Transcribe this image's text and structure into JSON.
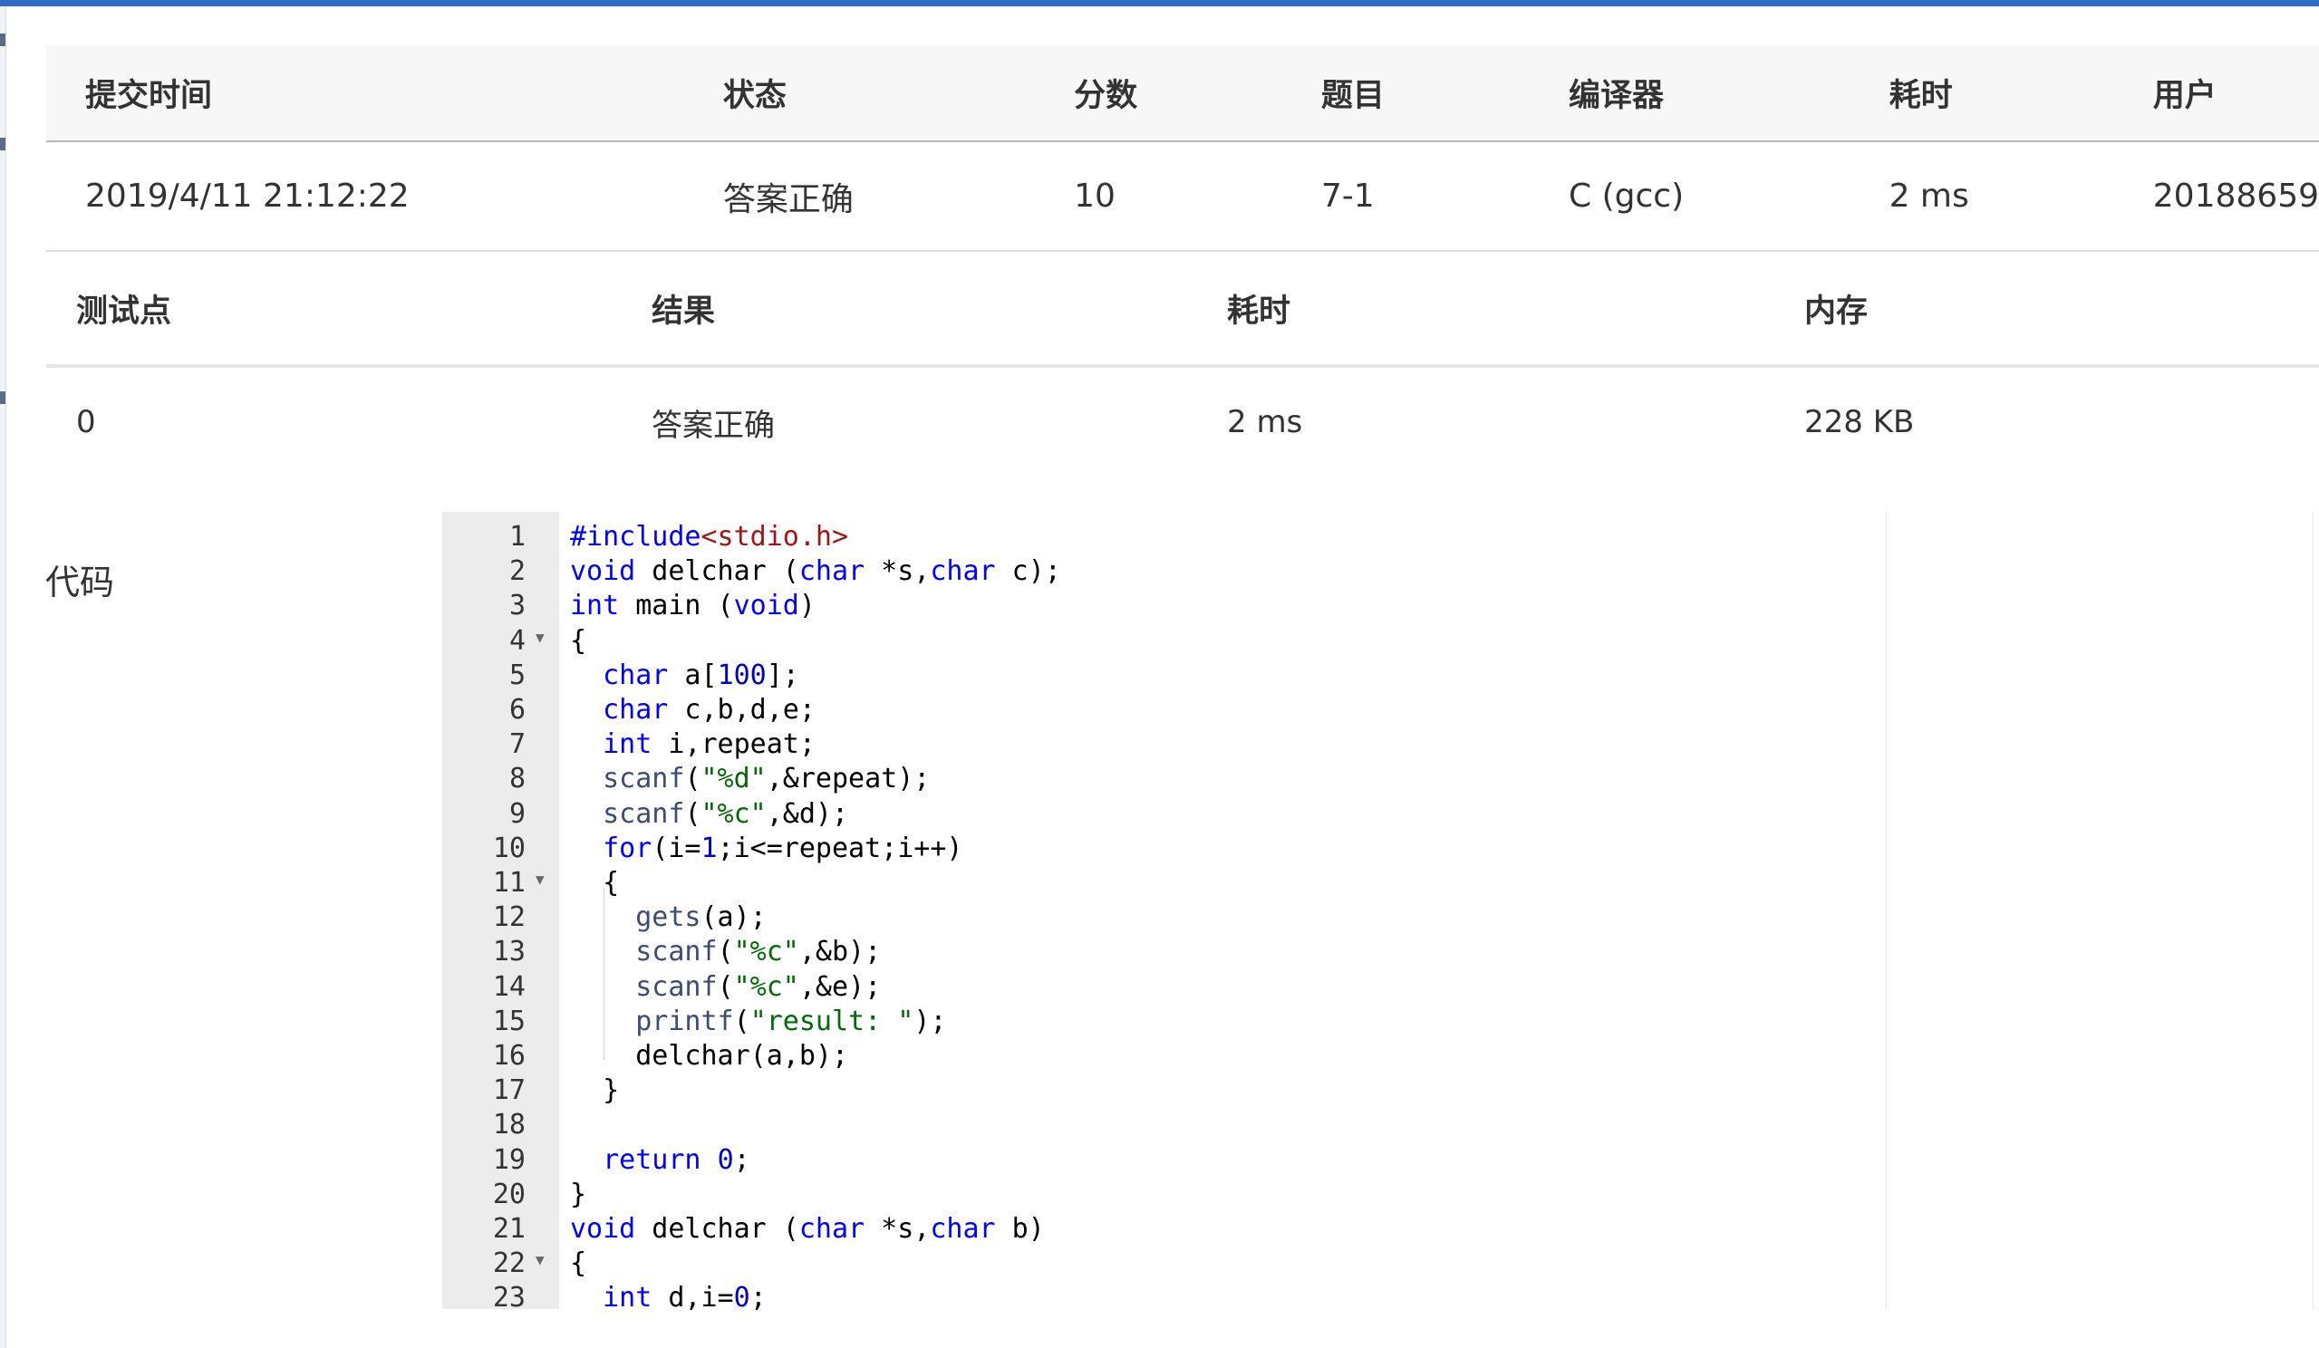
{
  "summary": {
    "headers": [
      "提交时间",
      "状态",
      "分数",
      "题目",
      "编译器",
      "耗时",
      "用户"
    ],
    "row": {
      "time": "2019/4/11 21:12:22",
      "status": "答案正确",
      "score": "10",
      "problem": "7-1",
      "compiler": "C (gcc)",
      "elapsed": "2 ms",
      "user": "20188659"
    }
  },
  "cases": {
    "headers": [
      "测试点",
      "结果",
      "耗时",
      "内存"
    ],
    "rows": [
      {
        "id": "0",
        "result": "答案正确",
        "elapsed": "2 ms",
        "memory": "228 KB"
      }
    ]
  },
  "code_label": "代码",
  "code": {
    "lines": [
      {
        "n": "1",
        "fold": false,
        "text": "#include<stdio.h>"
      },
      {
        "n": "2",
        "fold": false,
        "text": "void delchar (char *s,char c);"
      },
      {
        "n": "3",
        "fold": false,
        "text": "int main (void)"
      },
      {
        "n": "4",
        "fold": true,
        "text": "{"
      },
      {
        "n": "5",
        "fold": false,
        "text": "  char a[100];"
      },
      {
        "n": "6",
        "fold": false,
        "text": "  char c,b,d,e;"
      },
      {
        "n": "7",
        "fold": false,
        "text": "  int i,repeat;"
      },
      {
        "n": "8",
        "fold": false,
        "text": "  scanf(\"%d\",&repeat);"
      },
      {
        "n": "9",
        "fold": false,
        "text": "  scanf(\"%c\",&d);"
      },
      {
        "n": "10",
        "fold": false,
        "text": "  for(i=1;i<=repeat;i++)"
      },
      {
        "n": "11",
        "fold": true,
        "text": "  {"
      },
      {
        "n": "12",
        "fold": false,
        "text": "    gets(a);"
      },
      {
        "n": "13",
        "fold": false,
        "text": "    scanf(\"%c\",&b);"
      },
      {
        "n": "14",
        "fold": false,
        "text": "    scanf(\"%c\",&e);"
      },
      {
        "n": "15",
        "fold": false,
        "text": "    printf(\"result: \");"
      },
      {
        "n": "16",
        "fold": false,
        "text": "    delchar(a,b);"
      },
      {
        "n": "17",
        "fold": false,
        "text": "  }"
      },
      {
        "n": "18",
        "fold": false,
        "text": ""
      },
      {
        "n": "19",
        "fold": false,
        "text": "  return 0;"
      },
      {
        "n": "20",
        "fold": false,
        "text": "}"
      },
      {
        "n": "21",
        "fold": false,
        "text": "void delchar (char *s,char b)"
      },
      {
        "n": "22",
        "fold": true,
        "text": "{"
      },
      {
        "n": "23",
        "fold": false,
        "text": "  int d,i=0;"
      }
    ]
  },
  "colors": {
    "status_ok": "#e13b2b",
    "link": "#1c5fa8",
    "top_bar": "#2f6cc4",
    "keyword": "#0000ff"
  },
  "icons": {
    "fold": "fold-arrow-icon"
  }
}
